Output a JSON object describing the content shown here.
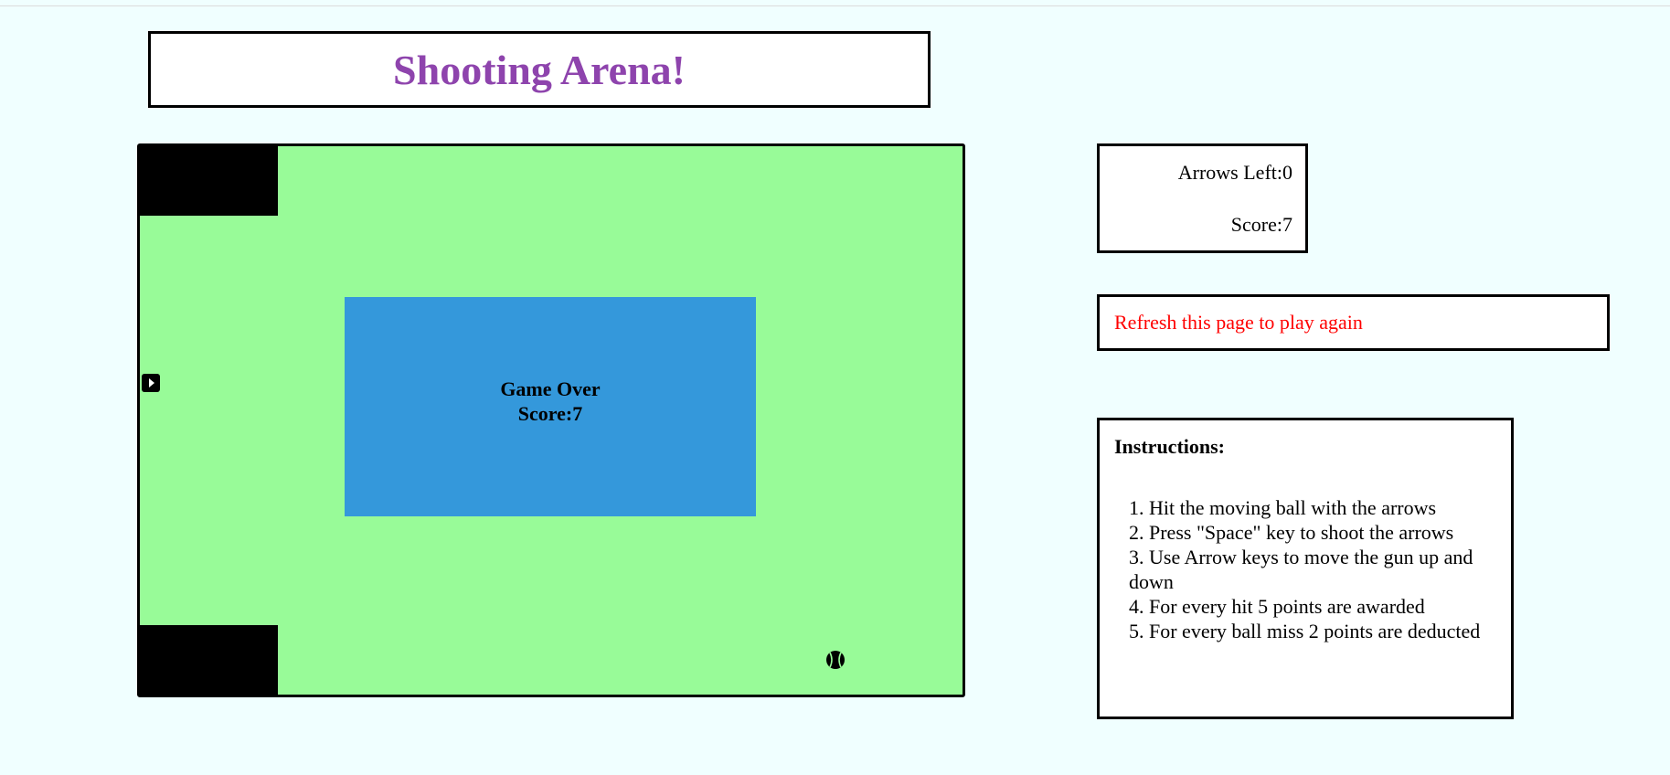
{
  "header": {
    "title": "Shooting Arena!",
    "title_color": "#8e44ad"
  },
  "arena": {
    "background_color": "#98fb98",
    "gun_icon": "play-arrow-icon",
    "ball_icon": "ball-icon",
    "game_over": {
      "line1": "Game Over",
      "line2": "Score:7",
      "panel_color": "#3498db"
    }
  },
  "stats": {
    "arrows_left": "Arrows Left:0",
    "score": "Score:7"
  },
  "refresh": {
    "message": "Refresh this page to play again",
    "color": "#ff0000"
  },
  "instructions": {
    "heading": "Instructions:",
    "items": [
      "1. Hit the moving ball with the arrows",
      "2. Press \"Space\" key to shoot the arrows",
      "3. Use Arrow keys to move the gun up and down",
      "4. For every hit 5 points are awarded",
      "5. For every ball miss 2 points are deducted"
    ]
  }
}
